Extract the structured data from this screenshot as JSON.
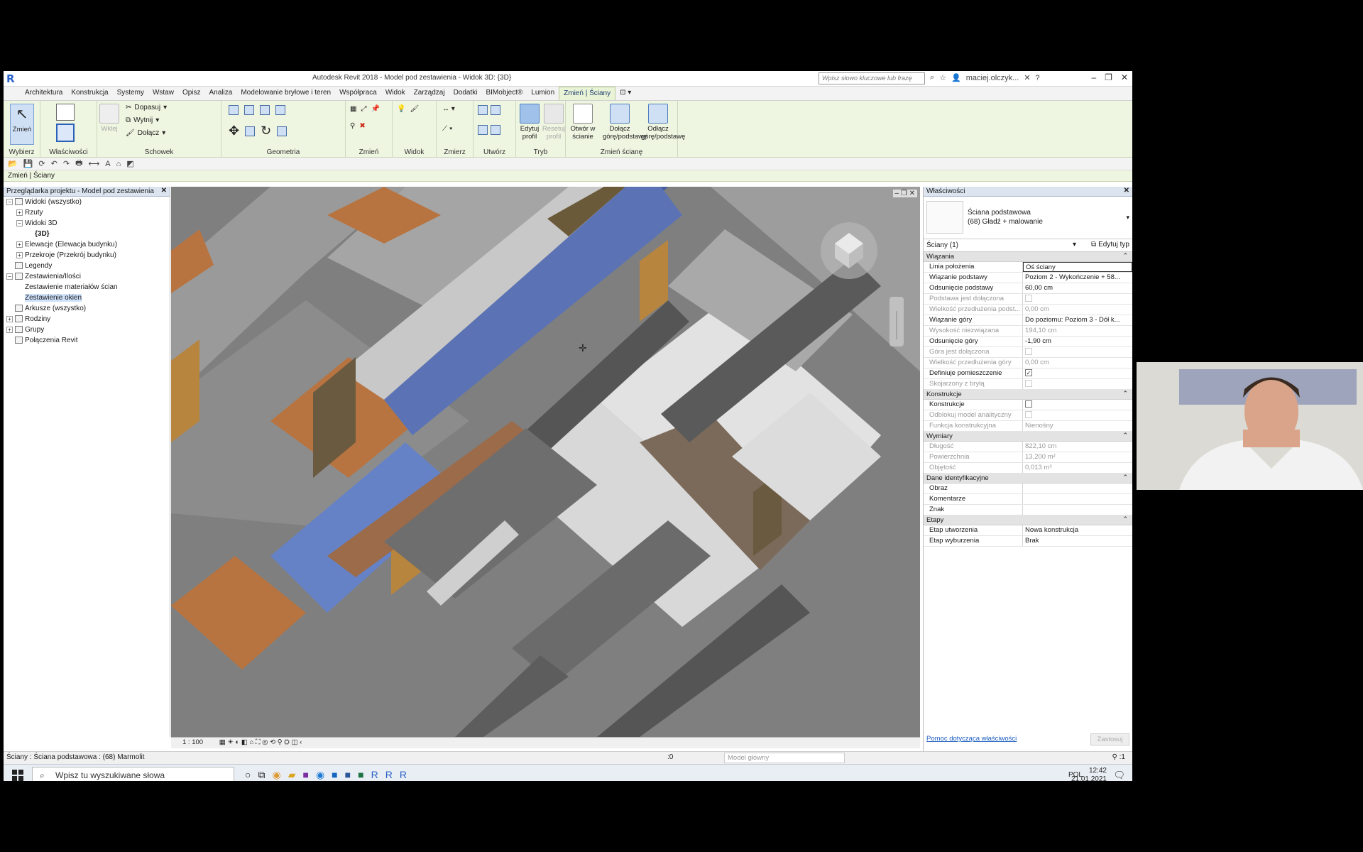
{
  "titlebar": {
    "app_title": "Autodesk Revit 2018 -    Model pod zestawienia - Widok 3D: {3D}",
    "search_placeholder": "Wpisz słowo kluczowe lub frazę",
    "user": "maciej.olczyk..."
  },
  "tabs": [
    "Architektura",
    "Konstrukcja",
    "Systemy",
    "Wstaw",
    "Opisz",
    "Analiza",
    "Modelowanie bryłowe i teren",
    "Współpraca",
    "Widok",
    "Zarządzaj",
    "Dodatki",
    "BIMobject®",
    "Lumion",
    "Zmień | Ściany"
  ],
  "ribbon": {
    "modify": "Zmień",
    "paste": "Wklej",
    "fit": "Dopasuj",
    "cut": "Wytnij",
    "join": "Dołącz",
    "edit_profile": "Edytuj profil",
    "reset_profile": "Resetuj profil",
    "opening_in_wall": "Otwór w ścianie",
    "attach_top_base": "Dołącz górę/podstawę",
    "detach_top_base": "Odłącz górę/podstawę",
    "groups": [
      "Wybierz",
      "Właściwości",
      "Schowek",
      "Geometria",
      "Zmień",
      "Widok",
      "Zmierz",
      "Utwórz",
      "Tryb",
      "Zmień ścianę"
    ]
  },
  "context_bar": "Zmień | Ściany",
  "browser": {
    "title": "Przeglądarka projektu - Model pod zestawienia",
    "items": [
      {
        "label": "Widoki (wszystko)",
        "level": 0,
        "exp": "−"
      },
      {
        "label": "Rzuty",
        "level": 1,
        "exp": "+"
      },
      {
        "label": "Widoki 3D",
        "level": 1,
        "exp": "−"
      },
      {
        "label": "{3D}",
        "level": 2,
        "exp": ""
      },
      {
        "label": "Elewacje (Elewacja budynku)",
        "level": 1,
        "exp": "+"
      },
      {
        "label": "Przekroje (Przekrój budynku)",
        "level": 1,
        "exp": "+"
      },
      {
        "label": "Legendy",
        "level": 0,
        "exp": ""
      },
      {
        "label": "Zestawienia/Ilości",
        "level": 0,
        "exp": "−"
      },
      {
        "label": "Zestawienie materiałów ścian",
        "level": 1,
        "exp": ""
      },
      {
        "label": "Zestawienie okien",
        "level": 1,
        "exp": ""
      },
      {
        "label": "Arkusze (wszystko)",
        "level": 0,
        "exp": ""
      },
      {
        "label": "Rodziny",
        "level": 0,
        "exp": "+"
      },
      {
        "label": "Grupy",
        "level": 0,
        "exp": "+"
      },
      {
        "label": "Połączenia Revit",
        "level": 0,
        "exp": ""
      }
    ]
  },
  "viewbar": {
    "scale": "1 : 100"
  },
  "properties": {
    "title": "Właściwości",
    "type_name": "Ściana podstawowa",
    "type_sub": "(68) Gładź + malowanie",
    "instance": "Ściany (1)",
    "edit_type": "Edytuj typ",
    "sections": [
      {
        "name": "Wiązania",
        "rows": [
          {
            "k": "Linia położenia",
            "v": "Oś ściany",
            "dis": false
          },
          {
            "k": "Wiązanie podstawy",
            "v": "Poziom 2 - Wykończenie + 58...",
            "dis": false
          },
          {
            "k": "Odsunięcie podstawy",
            "v": "60,00 cm",
            "dis": false
          },
          {
            "k": "Podstawa jest dołączona",
            "v": "",
            "dis": true,
            "cb": true
          },
          {
            "k": "Wielkość przedłużenia podst...",
            "v": "0,00 cm",
            "dis": true
          },
          {
            "k": "Wiązanie góry",
            "v": "Do poziomu: Poziom 3 - Dół k...",
            "dis": false
          },
          {
            "k": "Wysokość niezwiązana",
            "v": "194,10 cm",
            "dis": true
          },
          {
            "k": "Odsunięcie góry",
            "v": "-1,90 cm",
            "dis": false
          },
          {
            "k": "Góra jest dołączona",
            "v": "",
            "dis": true,
            "cb": true
          },
          {
            "k": "Wielkość przedłużenia góry",
            "v": "0,00 cm",
            "dis": true
          },
          {
            "k": "Definiuje pomieszczenie",
            "v": "",
            "dis": false,
            "cb": true,
            "checked": true
          },
          {
            "k": "Skojarzony z bryłą",
            "v": "",
            "dis": true,
            "cb": true
          }
        ]
      },
      {
        "name": "Konstrukcje",
        "rows": [
          {
            "k": "Konstrukcje",
            "v": "",
            "dis": false,
            "cb": true
          },
          {
            "k": "Odblokuj model analityczny",
            "v": "",
            "dis": true,
            "cb": true
          },
          {
            "k": "Funkcja konstrukcyjna",
            "v": "Nienośny",
            "dis": true
          }
        ]
      },
      {
        "name": "Wymiary",
        "rows": [
          {
            "k": "Długość",
            "v": "822,10 cm",
            "dis": true
          },
          {
            "k": "Powierzchnia",
            "v": "13,200 m²",
            "dis": true
          },
          {
            "k": "Objętość",
            "v": "0,013 m³",
            "dis": true
          }
        ]
      },
      {
        "name": "Dane identyfikacyjne",
        "rows": [
          {
            "k": "Obraz",
            "v": "",
            "dis": false
          },
          {
            "k": "Komentarze",
            "v": "",
            "dis": false
          },
          {
            "k": "Znak",
            "v": "",
            "dis": false
          }
        ]
      },
      {
        "name": "Etapy",
        "rows": [
          {
            "k": "Etap utworzenia",
            "v": "Nowa konstrukcja",
            "dis": false
          },
          {
            "k": "Etap wyburzenia",
            "v": "Brak",
            "dis": false
          }
        ]
      }
    ],
    "help_link": "Pomoc dotycząca właściwości",
    "apply": "Zastosuj"
  },
  "statusbar": {
    "text": "Ściany : Ściana podstawowa : (68) Marmolit",
    "model": "Model główny",
    "counter": ":0",
    "filter": ":1"
  },
  "taskbar": {
    "search": "Wpisz tu wyszukiwane słowa",
    "lang": "POL",
    "time": "12:42",
    "date": "21.01.2021"
  },
  "colors": {
    "selected_wall": "#5b73b5",
    "ribbon_bg": "#eef5e0",
    "floor_wood": "#b06a3a"
  }
}
